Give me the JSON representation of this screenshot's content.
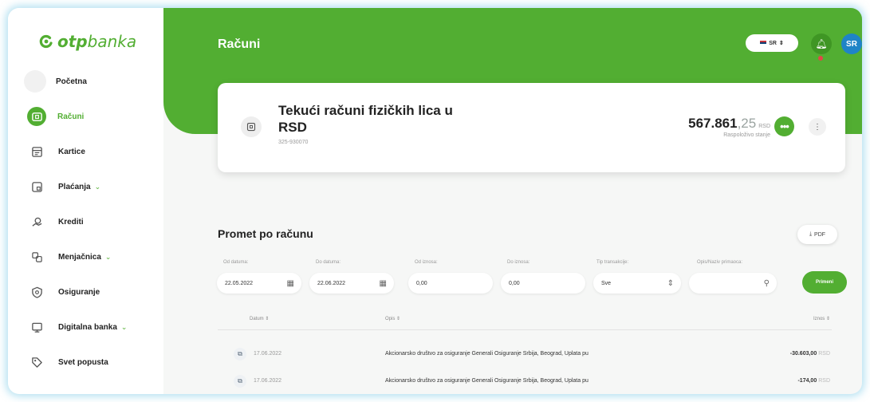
{
  "brand": {
    "bold": "otp",
    "light": "banka"
  },
  "sidebar": {
    "items": [
      {
        "label": "Početna",
        "icon": "home-icon"
      },
      {
        "label": "Računi",
        "icon": "account-icon",
        "active": true
      },
      {
        "label": "Kartice",
        "icon": "card-icon"
      },
      {
        "label": "Plaćanja",
        "icon": "payment-icon",
        "dropdown": true
      },
      {
        "label": "Krediti",
        "icon": "credit-icon"
      },
      {
        "label": "Menjačnica",
        "icon": "exchange-icon",
        "dropdown": true
      },
      {
        "label": "Osiguranje",
        "icon": "insurance-icon"
      },
      {
        "label": "Digitalna banka",
        "icon": "digital-icon",
        "dropdown": true
      },
      {
        "label": "Svet popusta",
        "icon": "discount-icon"
      }
    ]
  },
  "header": {
    "title": "Računi",
    "language": "SR",
    "avatar_initials": "SR"
  },
  "account": {
    "name": "Tekući računi fizičkih lica u RSD",
    "number": "325-930070",
    "balance_int": "567.861",
    "balance_dec": ",25",
    "currency": "RSD",
    "balance_label": "Raspoloživo stanje",
    "more_label": "•••",
    "kebab_label": "⋮"
  },
  "transactions": {
    "title": "Promet po računu",
    "pdf_label": "PDF",
    "filters": {
      "date_from": {
        "label": "Od datuma:",
        "value": "22.05.2022"
      },
      "date_to": {
        "label": "Do datuma:",
        "value": "22.06.2022"
      },
      "amount_from": {
        "label": "Od iznosa:",
        "value": "0,00"
      },
      "amount_to": {
        "label": "Do iznosa:",
        "value": "0,00"
      },
      "type": {
        "label": "Tip transakcije:",
        "value": "Sve"
      },
      "search": {
        "label": "Opis/Naziv primaoca:",
        "value": ""
      }
    },
    "apply_label": "Primeni",
    "columns": {
      "date": "Datum ⇕",
      "description": "Opis ⇕",
      "amount": "Iznos ⇕"
    },
    "rows": [
      {
        "date": "17.06.2022",
        "description": "Akcionarsko društvo za osiguranje Generali Osiguranje Srbija, Beograd, Uplata pu",
        "amount": "-30.603,00",
        "currency": "RSD"
      },
      {
        "date": "17.06.2022",
        "description": "Akcionarsko društvo za osiguranje Generali Osiguranje Srbija, Beograd, Uplata pu",
        "amount": "-174,00",
        "currency": "RSD"
      }
    ]
  },
  "colors": {
    "brand_green": "#52ae32",
    "avatar_blue": "#1f84c7",
    "notification_red": "#e04848"
  }
}
